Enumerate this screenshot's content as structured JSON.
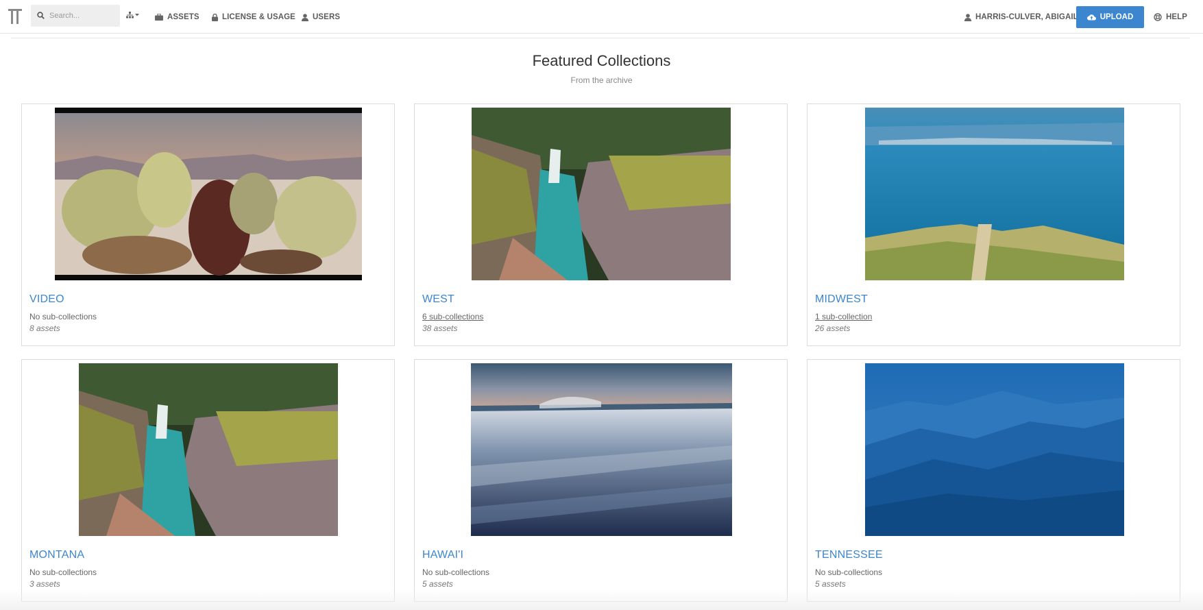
{
  "nav": {
    "search_placeholder": "Search...",
    "assets": "ASSETS",
    "license": "LICENSE & USAGE",
    "users": "USERS",
    "user_name": "HARRIS-CULVER, ABIGAIL",
    "upload": "UPLOAD",
    "help": "HELP"
  },
  "page": {
    "title": "Featured Collections",
    "subtitle": "From the archive"
  },
  "collections": [
    {
      "name": "VIDEO",
      "sub": "No sub-collections",
      "assets": "8 assets",
      "image": "cactus-desert"
    },
    {
      "name": "WEST",
      "sub": "6 sub-collections",
      "assets": "38 assets",
      "image": "canyon-creek"
    },
    {
      "name": "MIDWEST",
      "sub": "1 sub-collection",
      "assets": "26 assets",
      "image": "lake-dunes"
    },
    {
      "name": "MONTANA",
      "sub": "No sub-collections",
      "assets": "3 assets",
      "image": "canyon-creek"
    },
    {
      "name": "HAWAI'I",
      "sub": "No sub-collections",
      "assets": "5 assets",
      "image": "ocean-surf"
    },
    {
      "name": "TENNESSEE",
      "sub": "No sub-collections",
      "assets": "5 assets",
      "image": "blue-ridges"
    }
  ],
  "colors": {
    "accent": "#3b86cf",
    "upload_button": "#3b86cf"
  }
}
